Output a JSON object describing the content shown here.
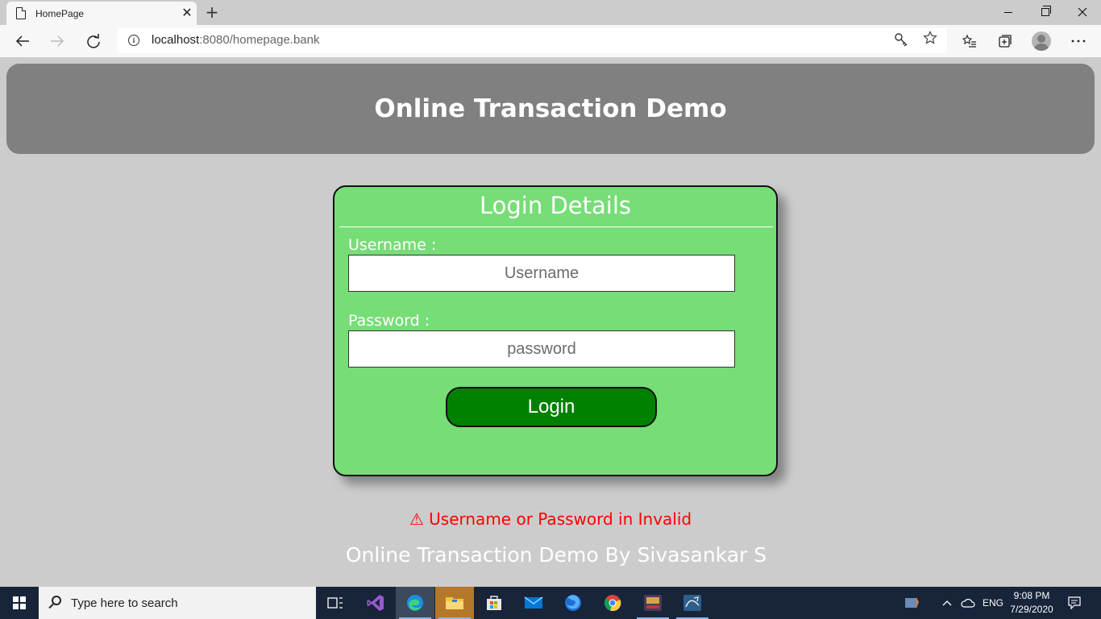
{
  "browser": {
    "tab_title": "HomePage",
    "tab_close": "✕",
    "new_tab": "+",
    "address_host": "localhost",
    "address_rest": ":8080/homepage.bank"
  },
  "page": {
    "header_title": "Online Transaction Demo",
    "login": {
      "title": "Login Details",
      "username_label": "Username :",
      "username_placeholder": "Username",
      "password_label": "Password :",
      "password_placeholder": "password",
      "button_label": "Login"
    },
    "error_message": "⚠ Username or Password in Invalid",
    "footer": "Online Transaction Demo By Sivasankar S"
  },
  "taskbar": {
    "search_placeholder": "Type here to search",
    "language": "ENG",
    "time": "9:08 PM",
    "date": "7/29/2020"
  },
  "colors": {
    "page_background": "#cccccc",
    "header_background": "#808080",
    "card_background": "#77dd77",
    "button_background": "#008000",
    "error_text": "#ff0000"
  }
}
